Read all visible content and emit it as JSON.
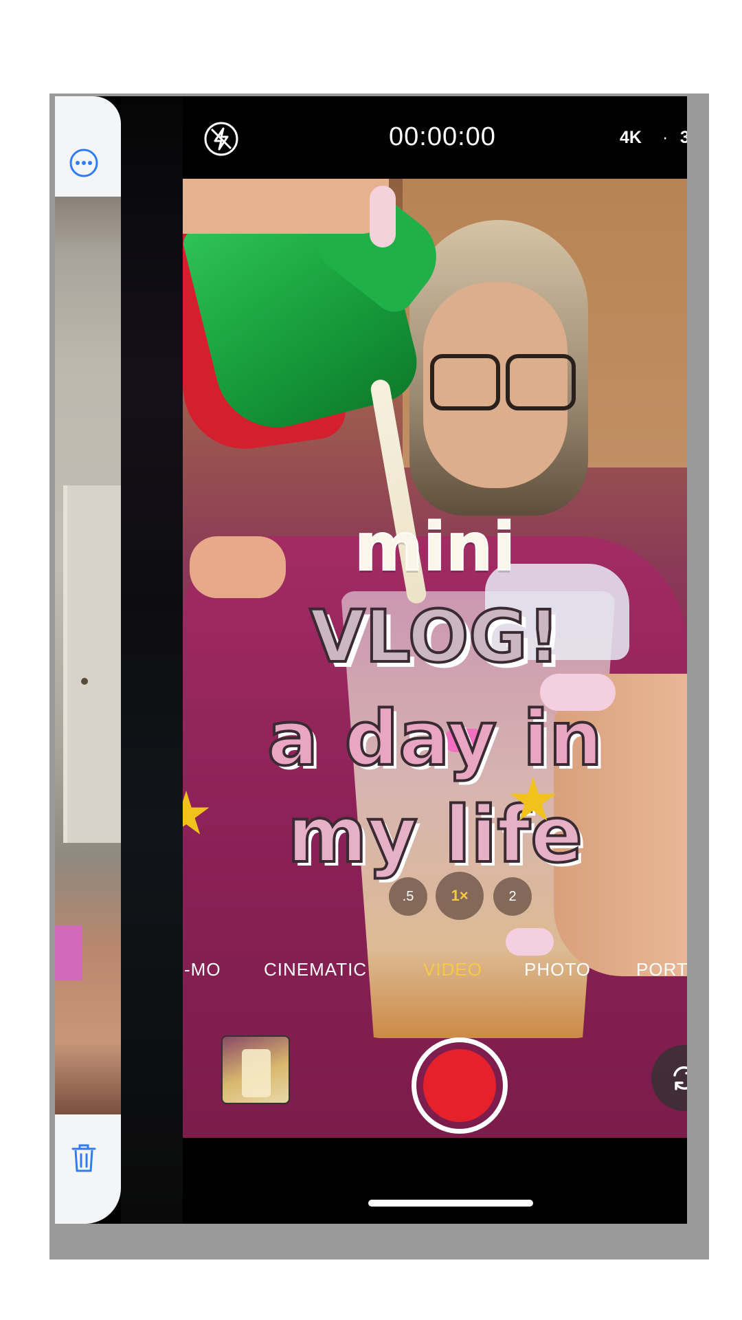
{
  "left_panel": {
    "more_icon": "ellipsis-circle-icon",
    "trash_icon": "trash-icon"
  },
  "camera": {
    "flash_icon": "flash-off-icon",
    "timer": "00:00:00",
    "format": "4K",
    "separator": "·",
    "fps": "3",
    "zoom_levels": [
      ".5",
      "1×",
      "2"
    ],
    "modes": [
      "-MO",
      "CINEMATIC",
      "VIDEO",
      "PHOTO",
      "PORT"
    ],
    "selected_mode": "VIDEO",
    "accent_color": "#f6c945",
    "record_color": "#e5222c"
  },
  "overlay": {
    "line1": "mini",
    "line2": "VLOG!",
    "line3": "a day in",
    "line4": "my life"
  }
}
